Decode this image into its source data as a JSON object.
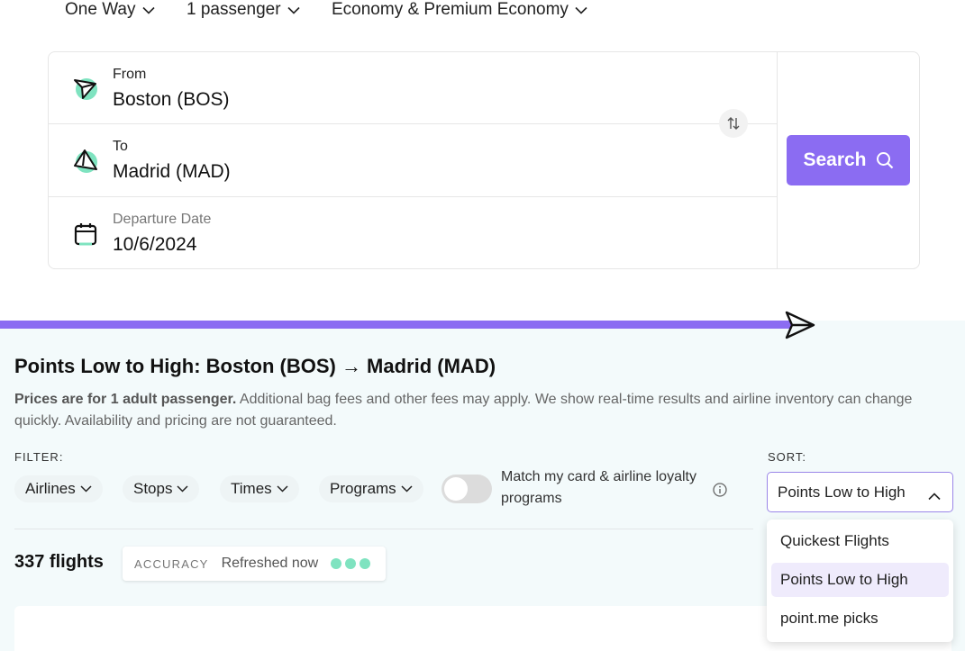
{
  "options": {
    "trip_type": "One Way",
    "passengers": "1 passenger",
    "cabin": "Economy & Premium Economy"
  },
  "search": {
    "from_label": "From",
    "from_value": "Boston (BOS)",
    "to_label": "To",
    "to_value": "Madrid (MAD)",
    "date_label": "Departure Date",
    "date_value": "10/6/2024",
    "button_label": "Search"
  },
  "progress": {
    "fraction": 0.82
  },
  "results": {
    "title": "Points Low to High: Boston (BOS) → Madrid (MAD)",
    "note_bold": "Prices are for 1 adult passenger.",
    "note_rest": " Additional bag fees and other fees may apply. We show real-time results and airline inventory can change quickly. Availability and pricing are not guaranteed.",
    "filter_label": "FILTER:",
    "filters": [
      "Airlines",
      "Stops",
      "Times",
      "Programs"
    ],
    "match_label": "Match my card & airline loyalty programs",
    "match_enabled": false,
    "sort_label": "SORT:",
    "sort_value": "Points Low to High",
    "sort_options": [
      "Quickest Flights",
      "Points Low to High",
      "point.me picks"
    ],
    "count": "337 flights",
    "accuracy_label": "ACCURACY",
    "accuracy_value": "Refreshed now"
  },
  "colors": {
    "accent": "#8b6cf2",
    "mint": "#7fe3c0",
    "results_bg": "#f3fafb"
  }
}
